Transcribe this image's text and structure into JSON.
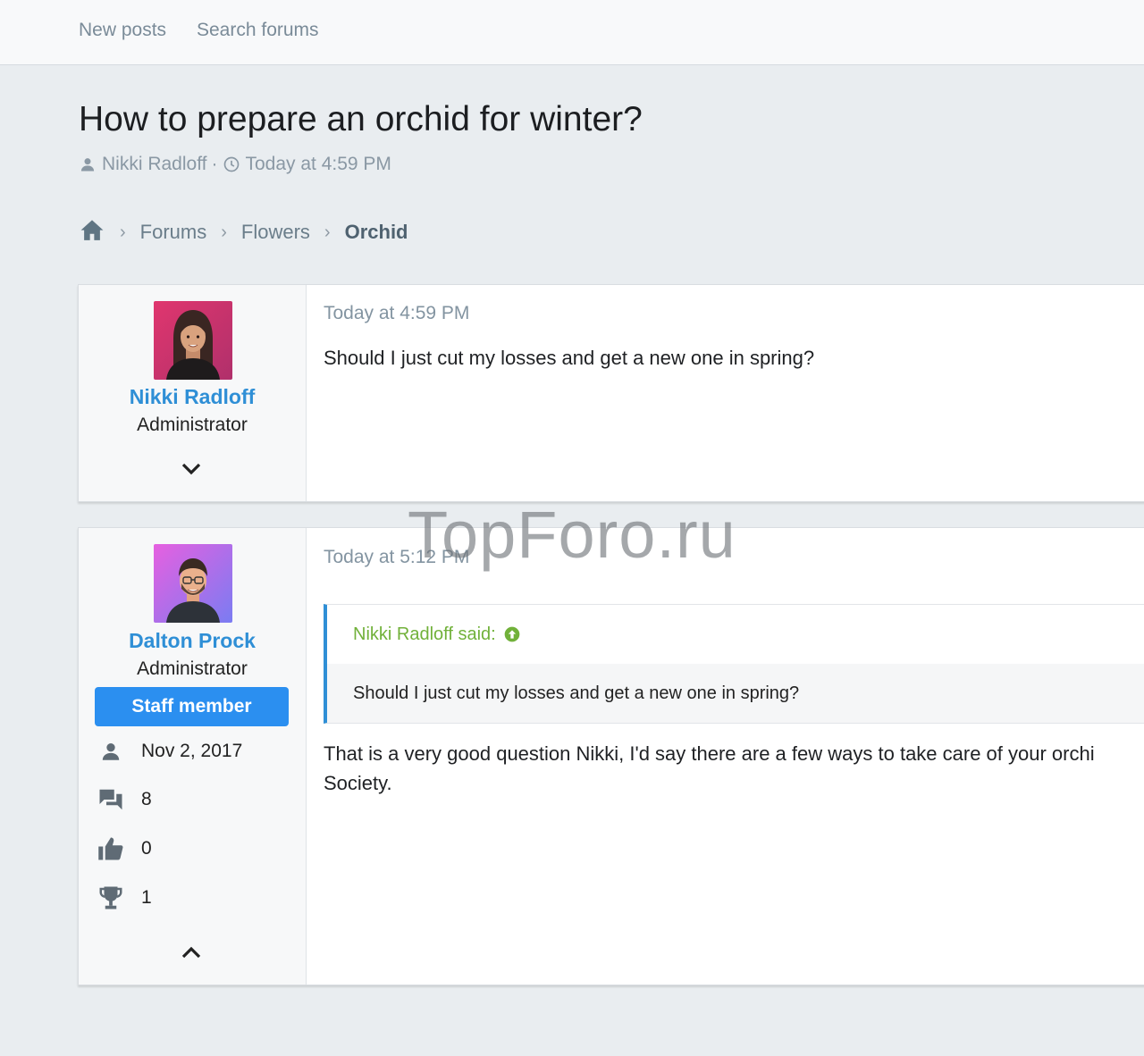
{
  "nav": {
    "new_posts": "New posts",
    "search_forums": "Search forums"
  },
  "thread": {
    "title": "How to prepare an orchid for winter?",
    "author": "Nikki Radloff",
    "separator": "·",
    "time": "Today at 4:59 PM"
  },
  "breadcrumb": {
    "home_icon": "home-icon",
    "items": [
      "Forums",
      "Flowers",
      "Orchid"
    ]
  },
  "posts": [
    {
      "user": {
        "name": "Nikki Radloff",
        "role": "Administrator"
      },
      "time": "Today at 4:59 PM",
      "body": "Should I just cut my losses and get a new one in spring?"
    },
    {
      "user": {
        "name": "Dalton Prock",
        "role": "Administrator",
        "banner": "Staff member",
        "joined": "Nov 2, 2017",
        "messages": "8",
        "reactions": "0",
        "points": "1"
      },
      "time": "Today at 5:12 PM",
      "quote": {
        "author": "Nikki Radloff said:",
        "text": "Should I just cut my losses and get a new one in spring?"
      },
      "body_line1": "That is a very good question Nikki, I'd say there are a few ways to take care of your orchi",
      "body_line2": "Society."
    }
  ],
  "watermark": "TopForo.ru",
  "colors": {
    "accent": "#2f8fd6",
    "staff_banner": "#2b8ff0",
    "quote_author": "#71b13a",
    "background": "#e9edf0"
  }
}
